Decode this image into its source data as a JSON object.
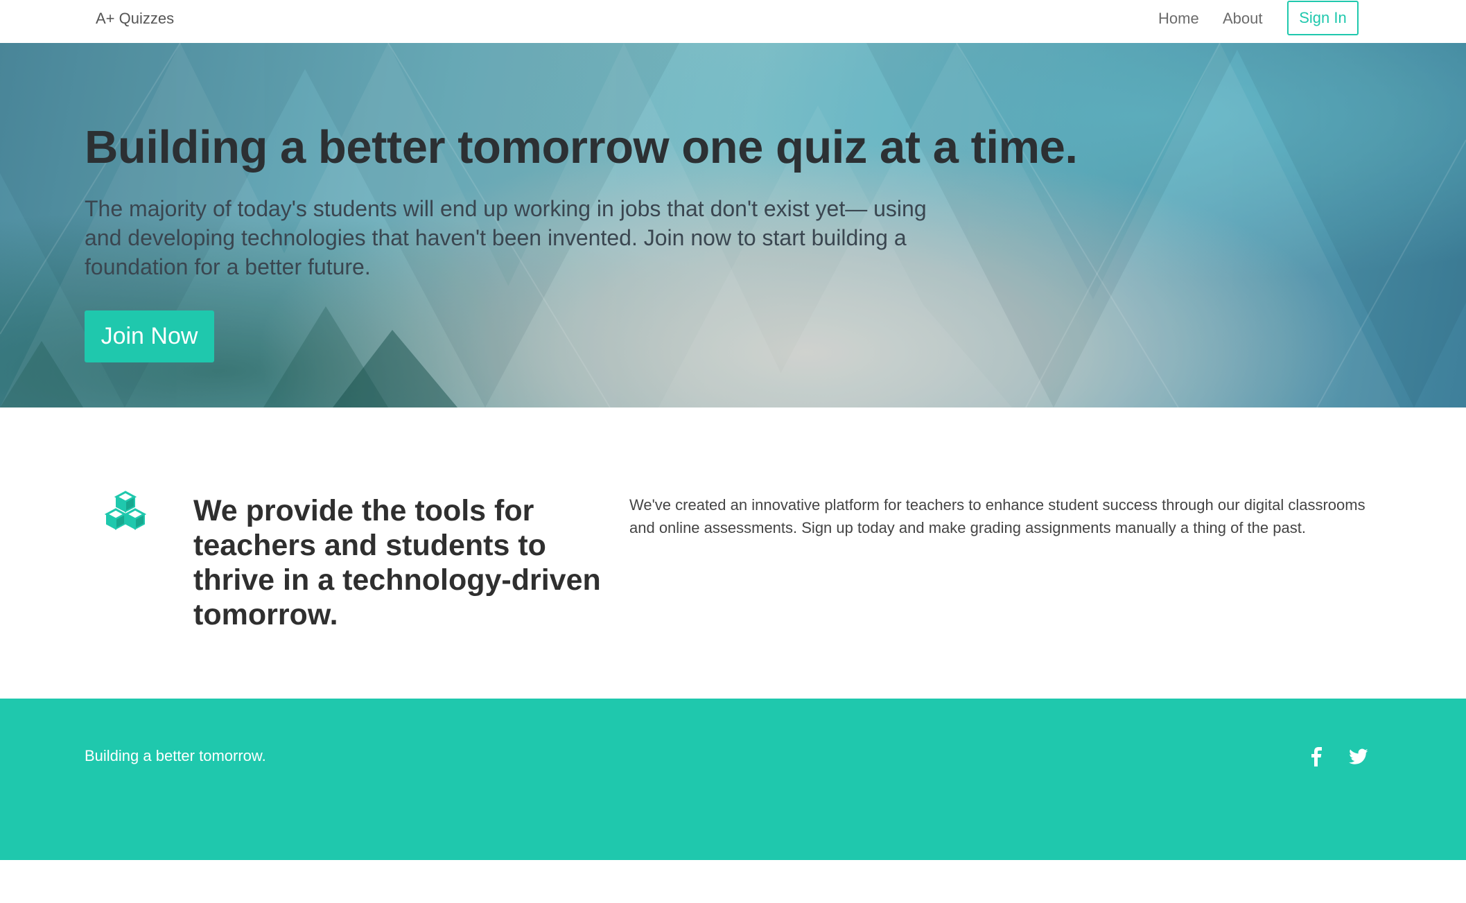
{
  "navbar": {
    "brand": "A+ Quizzes",
    "links": [
      "Home",
      "About"
    ],
    "signin_label": "Sign In"
  },
  "hero": {
    "title": "Building a better tomorrow one quiz at a time.",
    "subtitle": "The majority of today's students will end up working in jobs that don't exist yet— using and developing technologies that haven't been invented. Join now to start building a foundation for a better future.",
    "cta_label": "Join Now"
  },
  "feature": {
    "icon": "cubes-icon",
    "heading": "We provide the tools for teachers and students to thrive in a technology-driven tomorrow.",
    "text": "We've created an innovative platform for teachers to enhance student success through our digital classrooms and online assessments. Sign up today and make grading assignments manually a thing of the past."
  },
  "footer": {
    "tagline": "Building a better tomorrow.",
    "social": [
      "facebook-icon",
      "twitter-icon"
    ]
  },
  "colors": {
    "accent": "#1fc8ad",
    "text_dark": "#2c3033",
    "nav_text": "#6b6b6b"
  }
}
